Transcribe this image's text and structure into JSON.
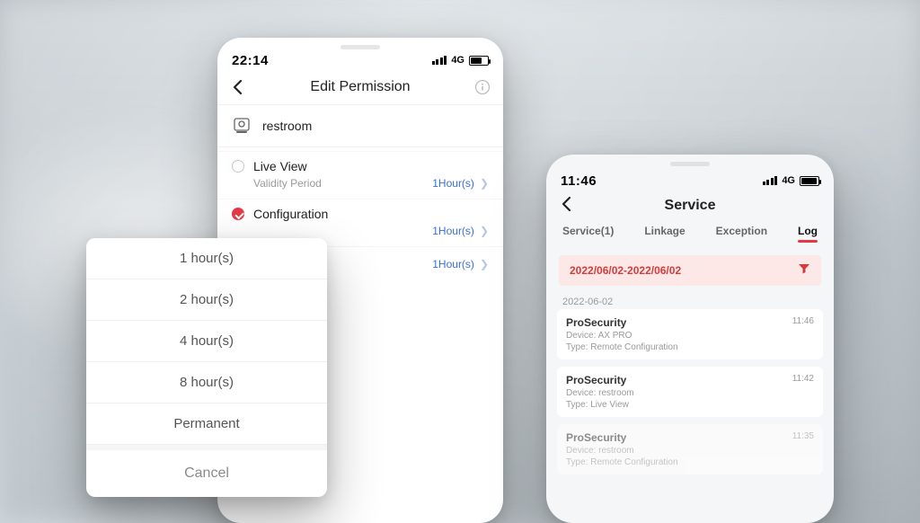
{
  "left_phone": {
    "status": {
      "time": "22:14",
      "network": "4G"
    },
    "nav": {
      "title": "Edit Permission"
    },
    "device": {
      "name": "restroom"
    },
    "permissions": [
      {
        "title": "Live View",
        "checked": false,
        "sub_label": "Validity Period",
        "value": "1Hour(s)"
      },
      {
        "title": "Configuration",
        "checked": true,
        "sub_label": "",
        "value": "1Hour(s)"
      }
    ],
    "extra_value": "1Hour(s)"
  },
  "sheet": {
    "options": [
      "1 hour(s)",
      "2 hour(s)",
      "4 hour(s)",
      "8 hour(s)",
      "Permanent"
    ],
    "cancel": "Cancel"
  },
  "right_phone": {
    "status": {
      "time": "11:46",
      "network": "4G"
    },
    "nav": {
      "title": "Service"
    },
    "tabs": [
      "Service(1)",
      "Linkage",
      "Exception",
      "Log"
    ],
    "active_tab_index": 3,
    "filter": {
      "range": "2022/06/02-2022/06/02"
    },
    "date_header": "2022-06-02",
    "logs": [
      {
        "title": "ProSecurity",
        "device_label": "Device:",
        "device": "AX PRO",
        "type_label": "Type:",
        "type": "Remote Configuration",
        "time": "11:46"
      },
      {
        "title": "ProSecurity",
        "device_label": "Device:",
        "device": "restroom",
        "type_label": "Type:",
        "type": "Live View",
        "time": "11:42"
      },
      {
        "title": "ProSecurity",
        "device_label": "Device:",
        "device": "restroom",
        "type_label": "Type:",
        "type": "Remote Configuration",
        "time": "11:35"
      }
    ]
  }
}
